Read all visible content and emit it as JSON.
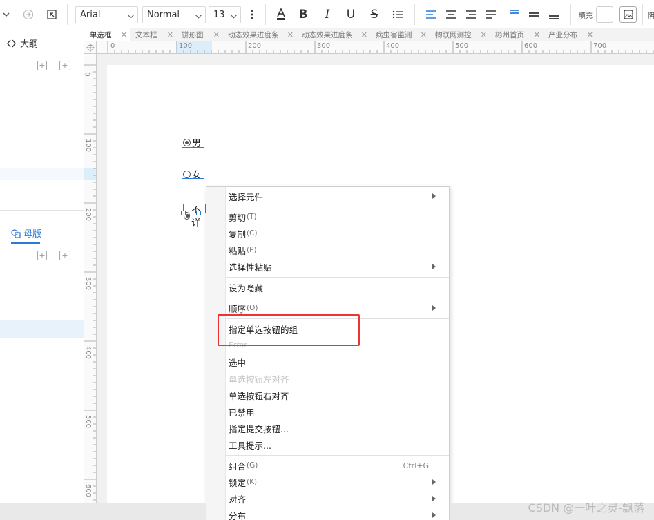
{
  "toolbar": {
    "font_family": "Arial",
    "font_style": "Normal",
    "font_size": "13",
    "bold": "B",
    "italic": "I",
    "underline": "U",
    "strike": "S",
    "fill_label": "填充",
    "partial_label": "阴"
  },
  "left_panel": {
    "outline_title": "大纲",
    "master_title": "母版"
  },
  "tabs": [
    {
      "label": "单选框",
      "active": true
    },
    {
      "label": "文本框"
    },
    {
      "label": "饼形图"
    },
    {
      "label": "动态效果进度条"
    },
    {
      "label": "动态效果进度条"
    },
    {
      "label": "病虫害监测"
    },
    {
      "label": "物联网测控"
    },
    {
      "label": "彬州首页"
    },
    {
      "label": "产业分布"
    }
  ],
  "hruler_labels": [
    "0",
    "100",
    "200",
    "300",
    "400",
    "500",
    "600",
    "700"
  ],
  "vruler_labels": [
    "0",
    "100",
    "200",
    "300",
    "400",
    "500",
    "600"
  ],
  "canvas": {
    "radio_male": "男",
    "radio_female": "女",
    "radio_secret": "不详"
  },
  "context_menu": {
    "select_component": "选择元件",
    "cut": "剪切",
    "cut_sc": "(T)",
    "copy": "复制",
    "copy_sc": "(C)",
    "paste": "粘贴",
    "paste_sc": "(P)",
    "paste_special": "选择性粘贴",
    "hide": "设为隐藏",
    "order": "顺序",
    "order_sc": "(O)",
    "assign_group": "指定单选按钮的组",
    "error": "Error",
    "selected": "选中",
    "align_left": "单选按钮左对齐",
    "align_right": "单选按钮右对齐",
    "disabled": "已禁用",
    "submit_button": "指定提交按钮...",
    "tooltip": "工具提示...",
    "group": "组合",
    "group_sc": "(G)",
    "group_kbd": "Ctrl+G",
    "lock": "锁定",
    "lock_sc": "(K)",
    "align": "对齐",
    "distribute": "分布"
  },
  "watermark": "CSDN @一叶之灵-飘落"
}
